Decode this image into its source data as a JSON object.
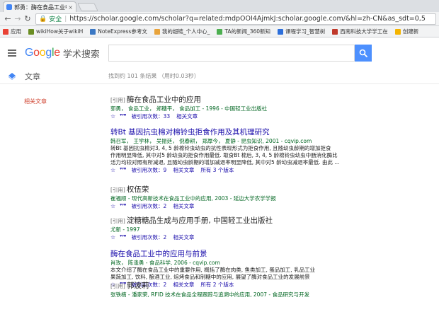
{
  "browser": {
    "tab_title": "郭勇：酶在食品工业中的",
    "tab_close": "×",
    "secure_label": "安全",
    "url": "https://scholar.google.com/scholar?q=related:mdpOOI4AjmkJ:scholar.google.com/&hl=zh-CN&as_sdt=0,5",
    "bookmarks": [
      {
        "label": "应用",
        "color": "#e94235"
      },
      {
        "label": "wikiHow关于wikiH",
        "color": "#6b8e23"
      },
      {
        "label": "NoteExpress参考文",
        "color": "#3b78c4"
      },
      {
        "label": "我的超链_个人中心_",
        "color": "#e8a33b"
      },
      {
        "label": "TA的新闻_360新知",
        "color": "#4caf50"
      },
      {
        "label": "课程学习_智慧树",
        "color": "#2c6fdb"
      },
      {
        "label": "西南科技大学学工在",
        "color": "#c0392b"
      },
      {
        "label": "创建新",
        "color": "#f4b400"
      }
    ]
  },
  "header": {
    "logo_letters": [
      "G",
      "o",
      "o",
      "g",
      "l",
      "e"
    ],
    "logo_sub": "学术搜索",
    "search_value": ""
  },
  "subbar": {
    "articles_label": "文章",
    "result_count": "找到约 101 条结果 （用时0.03秒）"
  },
  "sidebar": {
    "related_label": "相关文章"
  },
  "results": [
    {
      "tag": "[引用]",
      "title": "酶在食品工业中的应用",
      "meta": "郭勇， 食品工业， 郑穗平， 食品加工 - 1996 - 中国轻工业出版社",
      "snippet": [],
      "links": [
        "被引用次数：33",
        "相关文章"
      ]
    },
    {
      "tag": "",
      "title": "转Bt 基因抗虫棉对棉铃虫拒食作用及其机理研究",
      "meta": "韩召军， 王学林， 吴振廷， 倪春耕， 郑厚今， 夏静 - 昆虫知识, 2001 - cqvip.com",
      "snippet": [
        "转Bt 基因抗虫棉对3, 4, 5 龄棉铃虫幼虫的抗性表现形式为拒食作用, 且随幼虫龄期的增加拒食",
        "作用明显降低, 其中对5 龄幼虫的拒食作用最低. 取食Bt 棉后, 3, 4, 5 龄棉铃虫幼虫中肠消化酶比",
        "活力均较对照有所减退, 且随幼虫龄期的增加减退率明显降低, 其中对5 龄幼虫减退率最低. 由此 ..."
      ],
      "links": [
        "被引用次数：9",
        "相关文章",
        "所有 3 个版本"
      ]
    },
    {
      "tag": "[引用]",
      "title": "权伍荣",
      "meta": "崔福顺 - 现代高新技术在食品工业中的应用, 2003 - 延边大学农学学报",
      "snippet": [],
      "links": [
        "被引用次数：2",
        "相关文章"
      ]
    },
    {
      "tag": "[引用]",
      "title": "淀糖糖品生成与应用手册, 中国轻工业出版社",
      "meta": "尤新 - 1997",
      "snippet": [],
      "links": [
        "被引用次数：2",
        "相关文章"
      ]
    },
    {
      "tag": "",
      "title": "酶在食品工业中的应用与前景",
      "meta": "肖玫， 陈逢勇 - 食品科学, 2006 - cqvip.com",
      "snippet": [
        "本文介绍了酶在食品工业中的重要作用, 概括了酶在肉类, 鱼类加工, 蛋品加工, 乳品工业",
        "果蔬加工, 饮料, 酿酒工业, 焙烤食品和制糖中的应用, 展望了酶对食品工业的发展前景"
      ],
      "links": [
        "被引用次数：2",
        "相关文章",
        "所有 2 个版本"
      ]
    },
    {
      "tag": "[引用]",
      "title": "郭波莉",
      "meta": "张铁楠 - 潘家荣, RFID 技术在食品全程跟踪与追溯中的应用, 2007 - 食品研究与开发",
      "snippet": [],
      "links": []
    }
  ]
}
